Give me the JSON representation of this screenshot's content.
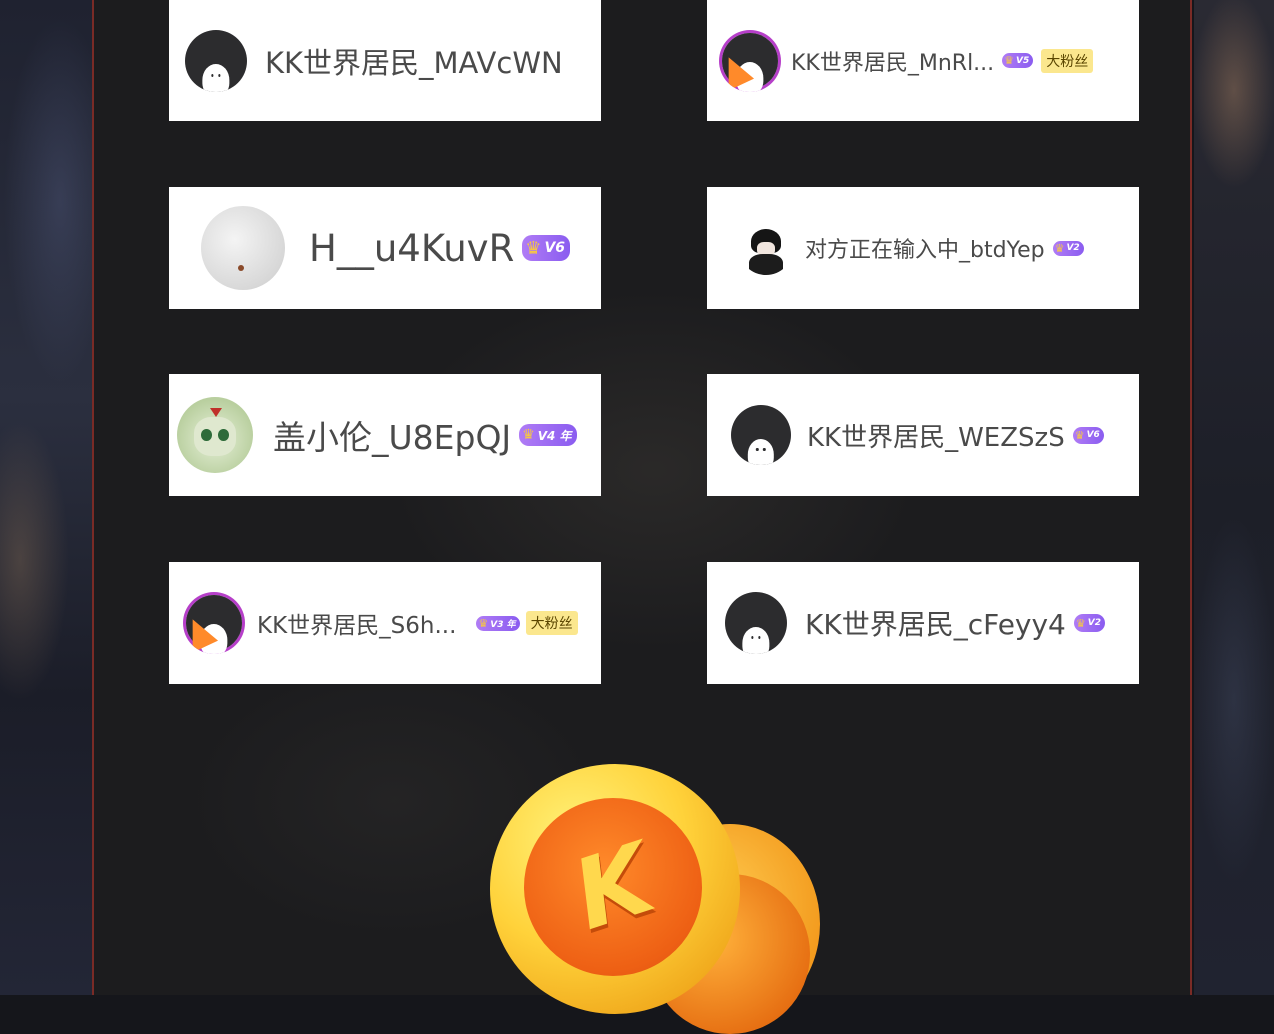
{
  "users": [
    {
      "name": "KK世界居民_MAVcWN",
      "avatar": "default-avatar",
      "vip": "",
      "fan_badge": ""
    },
    {
      "name": "KK世界居民_MnRl...",
      "avatar": "party-avatar",
      "vip": "V5",
      "fan_badge": "大粉丝"
    },
    {
      "name": "H__u4KuvR",
      "avatar": "photo-avatar",
      "vip": "V6",
      "fan_badge": ""
    },
    {
      "name": "对方正在输入中_btdYep",
      "avatar": "anime-boy-avatar",
      "vip": "V2",
      "fan_badge": ""
    },
    {
      "name": "盖小伦_U8EpQJ",
      "avatar": "cartoon-avatar",
      "vip": "V4 年",
      "fan_badge": ""
    },
    {
      "name": "KK世界居民_WEZSzS",
      "avatar": "default-avatar",
      "vip": "V6",
      "fan_badge": ""
    },
    {
      "name": "KK世界居民_S6h...",
      "avatar": "party-avatar",
      "vip": "V3 年",
      "fan_badge": "大粉丝"
    },
    {
      "name": "KK世界居民_cFeyy4",
      "avatar": "default-avatar",
      "vip": "V2",
      "fan_badge": ""
    }
  ],
  "coin": {
    "letter": "K",
    "icon": "kk-coin-icon"
  },
  "colors": {
    "border": "#7a2b26",
    "vip": "#8a5cf0",
    "fan_badge": "#fbe78e"
  }
}
